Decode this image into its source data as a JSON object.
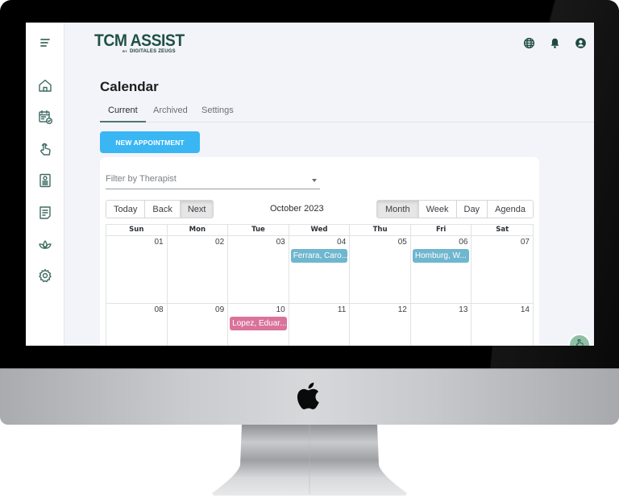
{
  "app": {
    "logo_title": "TCM ASSIST",
    "logo_by": "BY",
    "logo_subtitle": "DIGITALES ZEUGS",
    "brand_color": "#1f5148",
    "accent_color": "#3ab7f3"
  },
  "sidebar": {
    "items": [
      {
        "name": "menu",
        "icon": "hamburger-menu-icon"
      },
      {
        "name": "home",
        "icon": "home-icon"
      },
      {
        "name": "calendar",
        "icon": "calendar-check-icon"
      },
      {
        "name": "treatment",
        "icon": "hand-pointer-icon"
      },
      {
        "name": "patient-record",
        "icon": "id-document-icon"
      },
      {
        "name": "notes",
        "icon": "notes-icon"
      },
      {
        "name": "herbs",
        "icon": "lotus-icon"
      },
      {
        "name": "settings",
        "icon": "gear-icon"
      }
    ]
  },
  "header": {
    "icons": [
      "globe-icon",
      "bell-icon",
      "account-icon"
    ]
  },
  "page": {
    "title": "Calendar",
    "tabs": [
      {
        "label": "Current",
        "active": true
      },
      {
        "label": "Archived",
        "active": false
      },
      {
        "label": "Settings",
        "active": false
      }
    ],
    "new_appointment_label": "NEW APPOINTMENT"
  },
  "calendar": {
    "filter_placeholder": "Filter by Therapist",
    "nav_buttons": [
      {
        "label": "Today",
        "active": false
      },
      {
        "label": "Back",
        "active": false
      },
      {
        "label": "Next",
        "active": true
      }
    ],
    "month_label": "October 2023",
    "view_buttons": [
      {
        "label": "Month",
        "active": true
      },
      {
        "label": "Week",
        "active": false
      },
      {
        "label": "Day",
        "active": false
      },
      {
        "label": "Agenda",
        "active": false
      }
    ],
    "weekdays": [
      "Sun",
      "Mon",
      "Tue",
      "Wed",
      "Thu",
      "Fri",
      "Sat"
    ],
    "weeks": [
      [
        "01",
        "02",
        "03",
        "04",
        "05",
        "06",
        "07"
      ],
      [
        "08",
        "09",
        "10",
        "11",
        "12",
        "13",
        "14"
      ]
    ],
    "events": [
      {
        "week": 0,
        "day": 3,
        "label": "Ferrara, Caro...",
        "color": "#6fb6cf"
      },
      {
        "week": 0,
        "day": 5,
        "label": "Homburg, W...",
        "color": "#6fb6cf"
      },
      {
        "week": 1,
        "day": 2,
        "label": "Lopez, Eduar...",
        "color": "#d9739a"
      }
    ]
  },
  "fab": {
    "icon": "hand-pointer-icon"
  }
}
